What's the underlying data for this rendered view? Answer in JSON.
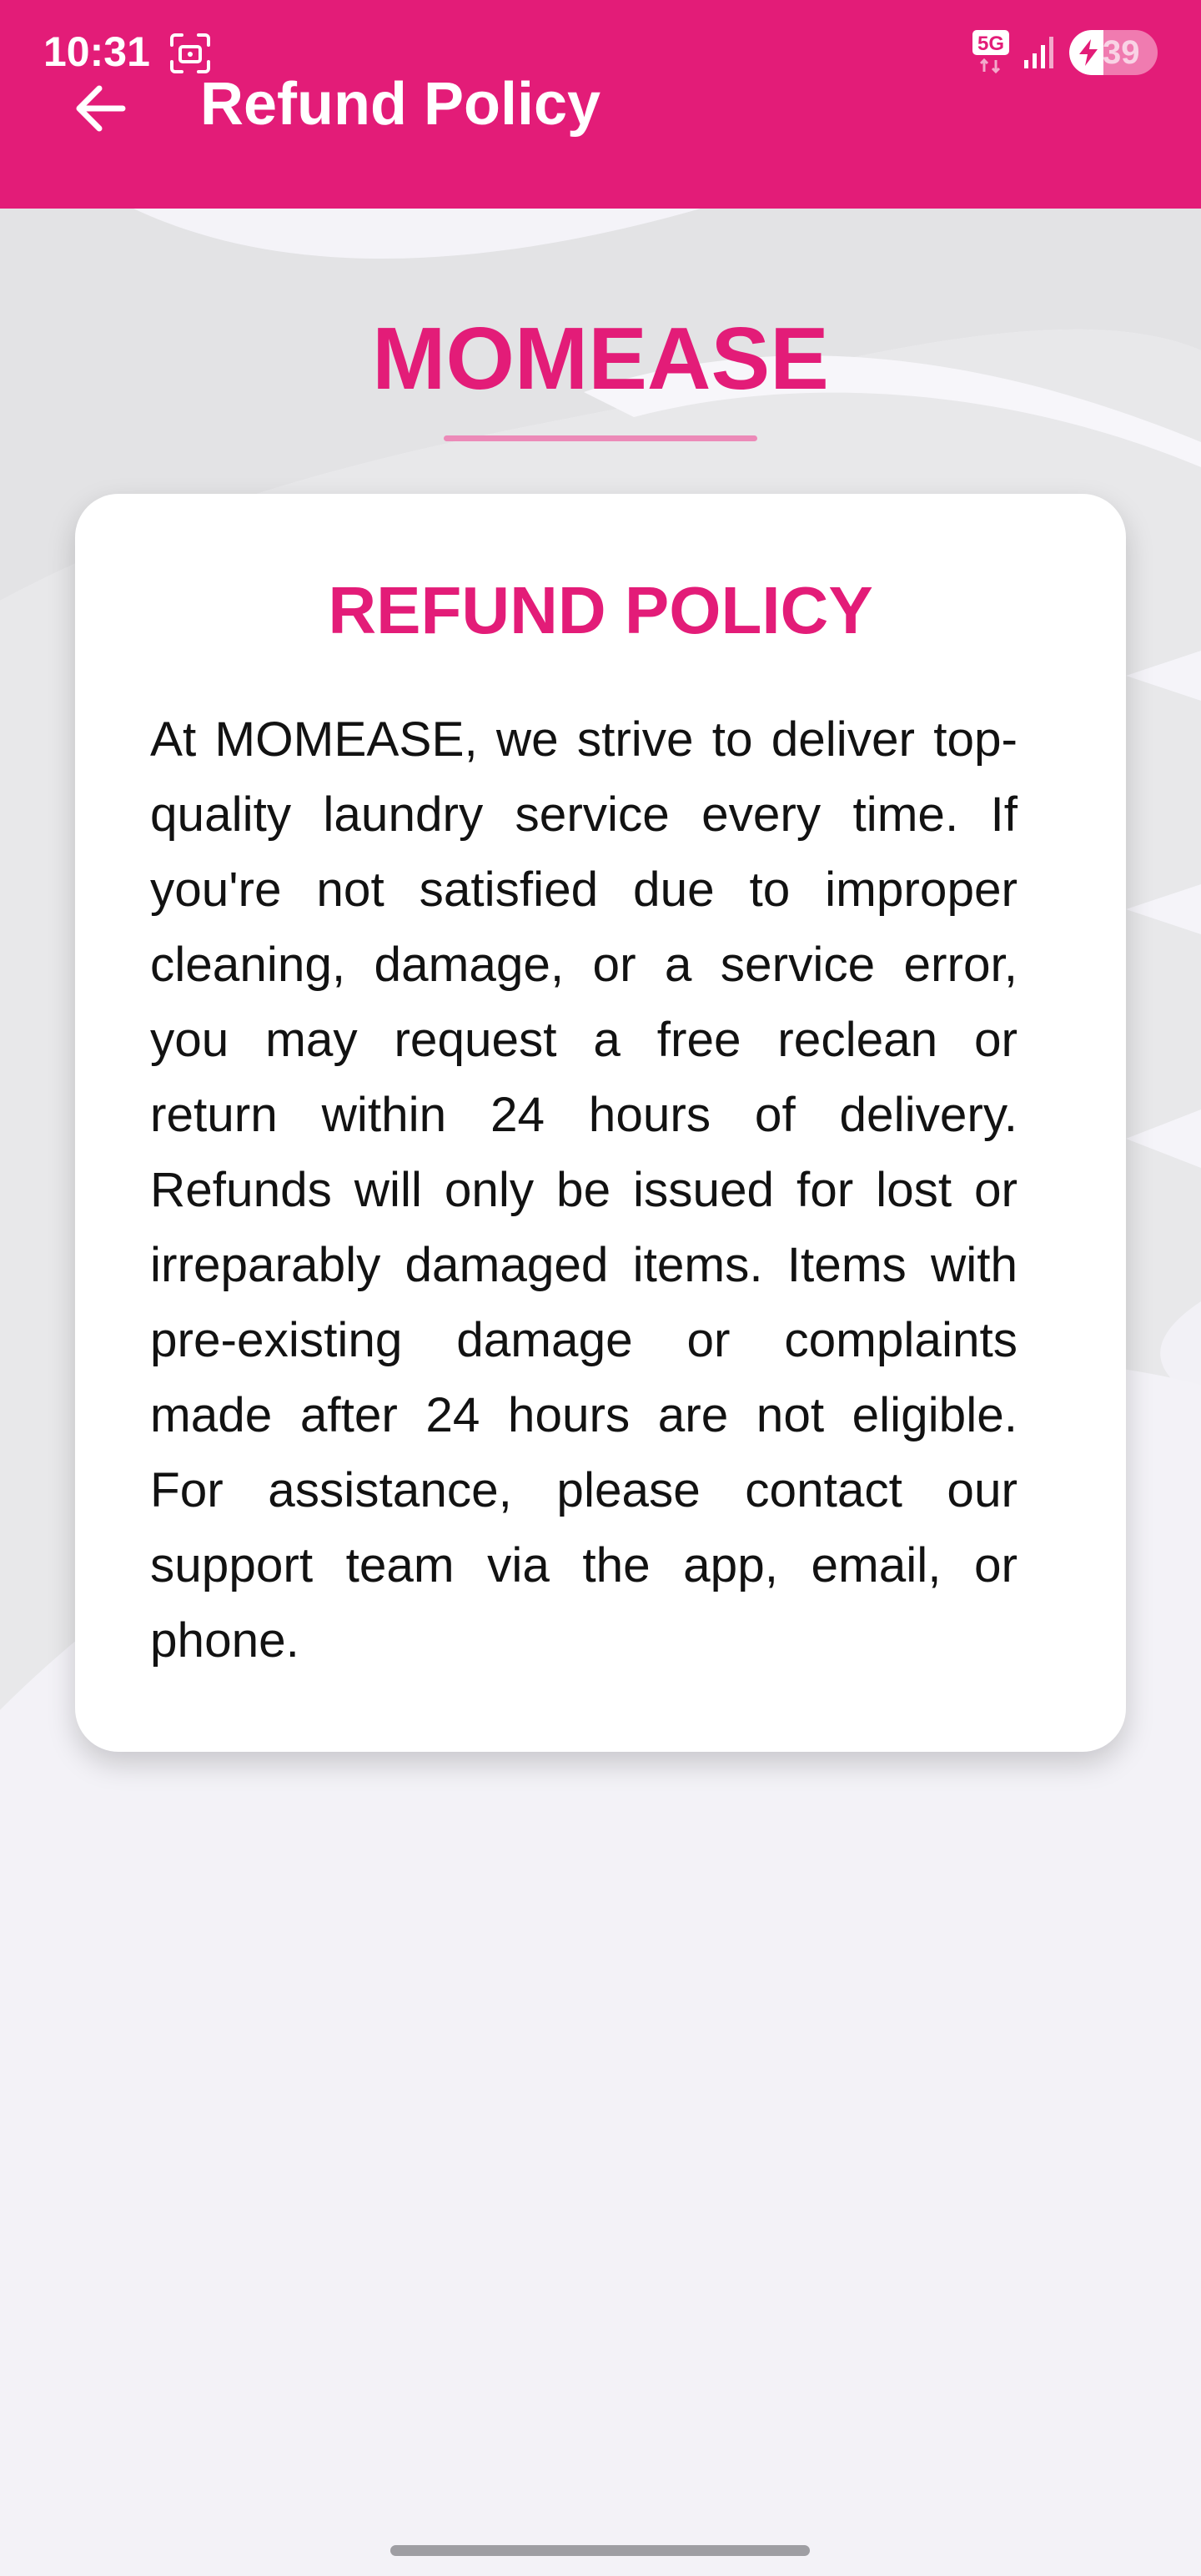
{
  "status_bar": {
    "time": "10:31",
    "network": "5G",
    "battery_level": "39",
    "battery_percent": 39,
    "icons": [
      "screenshot-icon",
      "5g-icon",
      "signal-icon",
      "charging-bolt-icon"
    ]
  },
  "app_bar": {
    "back_icon": "arrow-left-icon",
    "title": "Refund Policy"
  },
  "brand": {
    "name": "MOMEASE"
  },
  "card": {
    "title": "REFUND POLICY",
    "body": "At MOMEASE, we strive to deliver top-quality laundry service every time. If you're not satisfied due to improper cleaning, damage, or a service error, you may request a free reclean or return within 24 hours of delivery. Refunds will only be issued for lost or irreparably damaged items. Items with pre-existing damage or complaints made after 24 hours are not eligible. For assistance, please contact our support team via the app, email, or phone."
  },
  "colors": {
    "primary": "#e31c78",
    "background": "#f4f3f8",
    "card": "#ffffff",
    "text": "#121212",
    "decor": "#e2e2e4"
  }
}
